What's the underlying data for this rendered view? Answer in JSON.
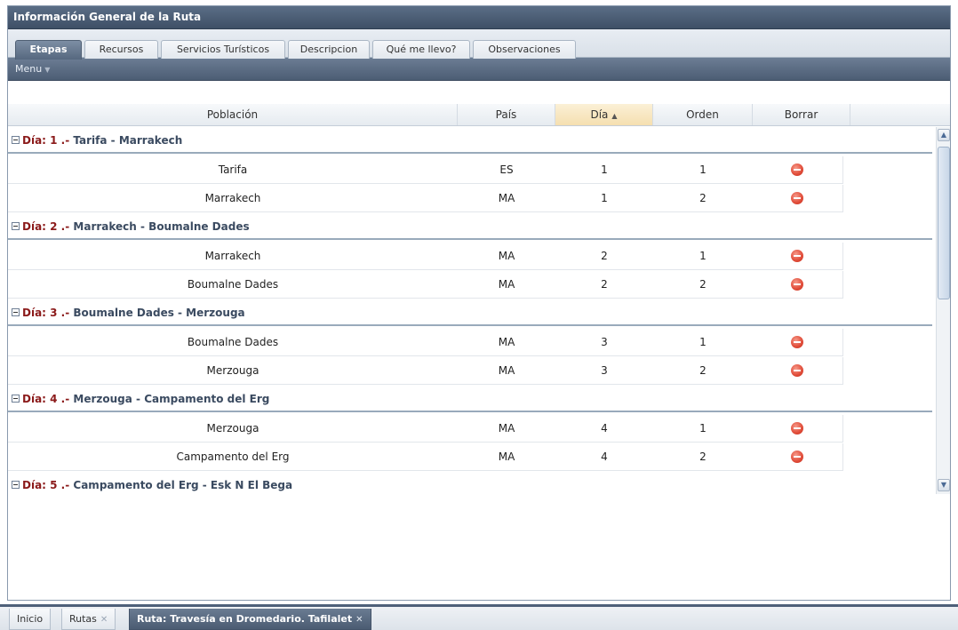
{
  "panel": {
    "title": "Información General de la Ruta"
  },
  "tabs": [
    {
      "label": "Etapas",
      "active": true
    },
    {
      "label": "Recursos"
    },
    {
      "label": "Servicios Turísticos"
    },
    {
      "label": "Descripcion"
    },
    {
      "label": "Qué me llevo?"
    },
    {
      "label": "Observaciones"
    }
  ],
  "toolbar": {
    "menu_label": "Menu"
  },
  "grid": {
    "columns": [
      "Población",
      "País",
      "Día",
      "Orden",
      "Borrar"
    ],
    "sorted_column": "Día",
    "sort_direction": "asc",
    "groups": [
      {
        "prefix": "Día: 1 .-",
        "route": "Tarifa - Marrakech",
        "rows": [
          [
            "Tarifa",
            "ES",
            "1",
            "1"
          ],
          [
            "Marrakech",
            "MA",
            "1",
            "2"
          ]
        ]
      },
      {
        "prefix": "Día: 2 .-",
        "route": "Marrakech - Boumalne Dades",
        "rows": [
          [
            "Marrakech",
            "MA",
            "2",
            "1"
          ],
          [
            "Boumalne Dades",
            "MA",
            "2",
            "2"
          ]
        ]
      },
      {
        "prefix": "Día: 3 .-",
        "route": "Boumalne Dades - Merzouga",
        "rows": [
          [
            "Boumalne Dades",
            "MA",
            "3",
            "1"
          ],
          [
            "Merzouga",
            "MA",
            "3",
            "2"
          ]
        ]
      },
      {
        "prefix": "Día: 4 .-",
        "route": "Merzouga - Campamento del Erg",
        "rows": [
          [
            "Merzouga",
            "MA",
            "4",
            "1"
          ],
          [
            "Campamento del Erg",
            "MA",
            "4",
            "2"
          ]
        ]
      },
      {
        "prefix": "Día: 5 .-",
        "route": "Campamento del Erg - Esk N El Bega",
        "rows": []
      }
    ]
  },
  "bottom_tabs": [
    {
      "label": "Inicio"
    },
    {
      "label": "Rutas",
      "closable": true
    },
    {
      "label": "Ruta: Travesía en Dromedario. Tafilalet",
      "closable": true,
      "active": true
    }
  ],
  "icons": {
    "delete": "delete-icon",
    "collapse": "collapse-icon",
    "close": "close-icon"
  },
  "colors": {
    "header_bg": "#4e6079",
    "group_prefix": "#8b1a1a",
    "delete_red": "#e04b38"
  }
}
